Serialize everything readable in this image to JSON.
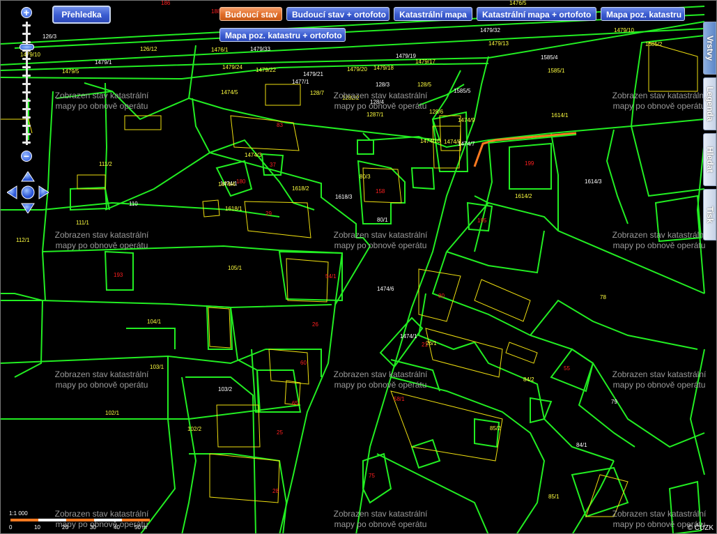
{
  "toolbar": {
    "overview": "Přehledka",
    "layers": [
      "Budoucí stav",
      "Budoucí stav + ortofoto",
      "Katastrální mapa",
      "Katastrální mapa + ortofoto",
      "Mapa poz. katastru",
      "Mapa poz. katastru + ortofoto"
    ],
    "active_layer": "Budoucí stav"
  },
  "side_tabs": [
    "Vrstvy",
    "Legenda",
    "Hledat",
    "Tisk"
  ],
  "zoom": {
    "in": "+",
    "out": "−",
    "level_fraction": 0.17
  },
  "notice": {
    "line1": "Zobrazen stav katastrální",
    "line2": "mapy po obnově operátu"
  },
  "scale": {
    "ratio": "1:1 000",
    "ticks": [
      "0",
      "10",
      "20",
      "30",
      "40",
      "50 m"
    ]
  },
  "copyright": "© ČÚZK",
  "colors": {
    "parcel": "#22ee22",
    "building": "#f0e010",
    "highlight": "#ff7a20",
    "label_yellow": "#ffff40",
    "label_red": "#ff2020",
    "text": "#ffffff"
  },
  "parcel_labels": [
    "126/3",
    "126/12",
    "1479/10",
    "1479/1",
    "1479/5",
    "1476/1",
    "1479/33",
    "1479/24",
    "1479/22",
    "1479/21",
    "1479/20",
    "1479/18",
    "1479/19",
    "1479/17",
    "1479/13",
    "1479/32",
    "1479/10",
    "1476/5",
    "1585/4",
    "1585/2",
    "1585/1",
    "1477/1",
    "1474/5",
    "1282/2",
    "128/3",
    "128/5",
    "128/7",
    "128/4",
    "1287/1",
    "128/6",
    "1585/5",
    "1474/10",
    "1474/3",
    "1474/1",
    "1474/4",
    "1474/9",
    "1474/7",
    "1474/8",
    "1614/1",
    "1614/3",
    "1614/2",
    "1618/2",
    "1618/3",
    "1618/1",
    "111/2",
    "110",
    "111/1",
    "112/1",
    "80/1",
    "80/3",
    "105/1",
    "1474/6",
    "104/1",
    "103/1",
    "103/2",
    "102/1",
    "102/2",
    "1474/1",
    "26/1",
    "84/2",
    "84/1",
    "85/2",
    "85/1",
    "79",
    "78"
  ],
  "building_numbers": [
    "186",
    "188",
    "83",
    "37",
    "180",
    "199",
    "195",
    "193",
    "158",
    "29",
    "54/1",
    "80",
    "21",
    "26",
    "60",
    "58/1",
    "55",
    "65",
    "25",
    "28",
    "75"
  ]
}
